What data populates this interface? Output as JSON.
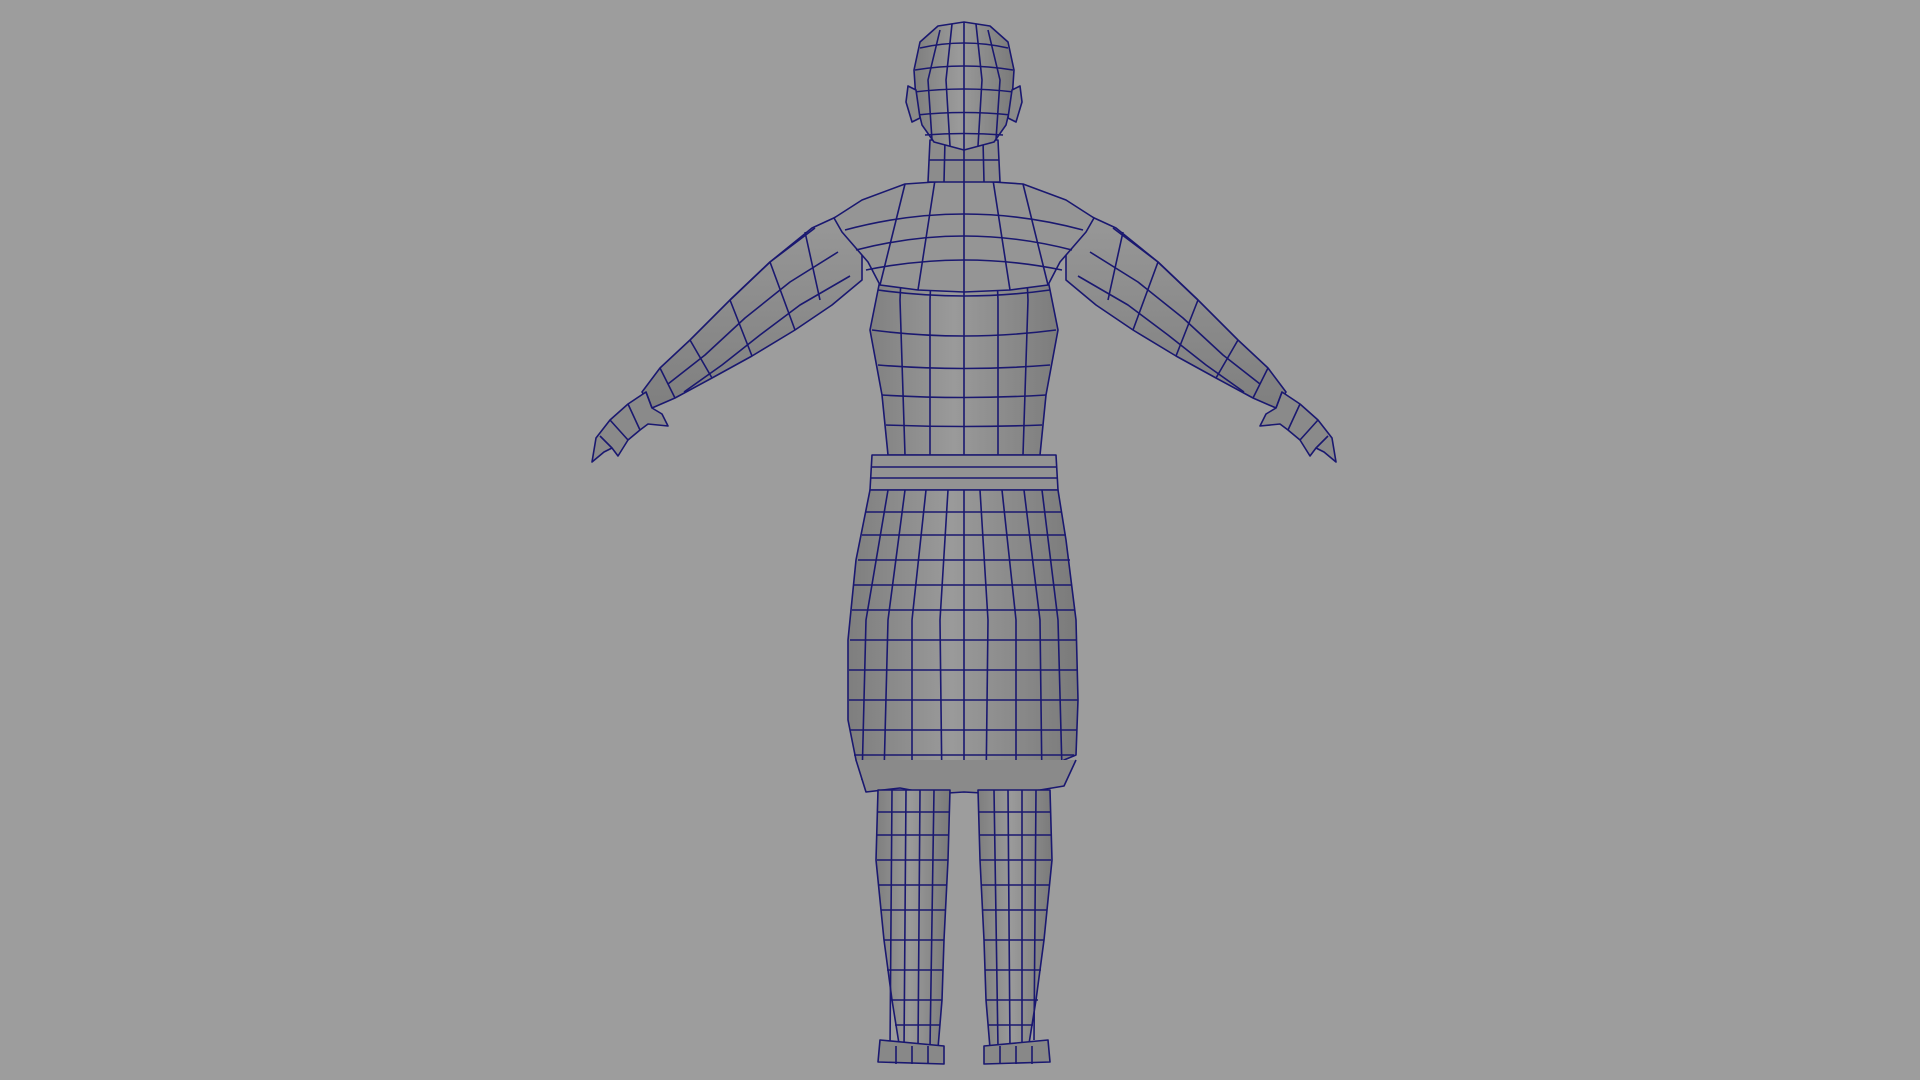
{
  "viewport": {
    "shading": "wireframe-on-shaded",
    "view": "back"
  },
  "model": {
    "subject": "character-mesh-t-pose"
  },
  "colors": {
    "background": "#9d9d9d",
    "surface": "#8c8c8c",
    "surface_light": "#9a9a9a",
    "surface_dark": "#7d7d7d",
    "wire": "#1a1870"
  }
}
